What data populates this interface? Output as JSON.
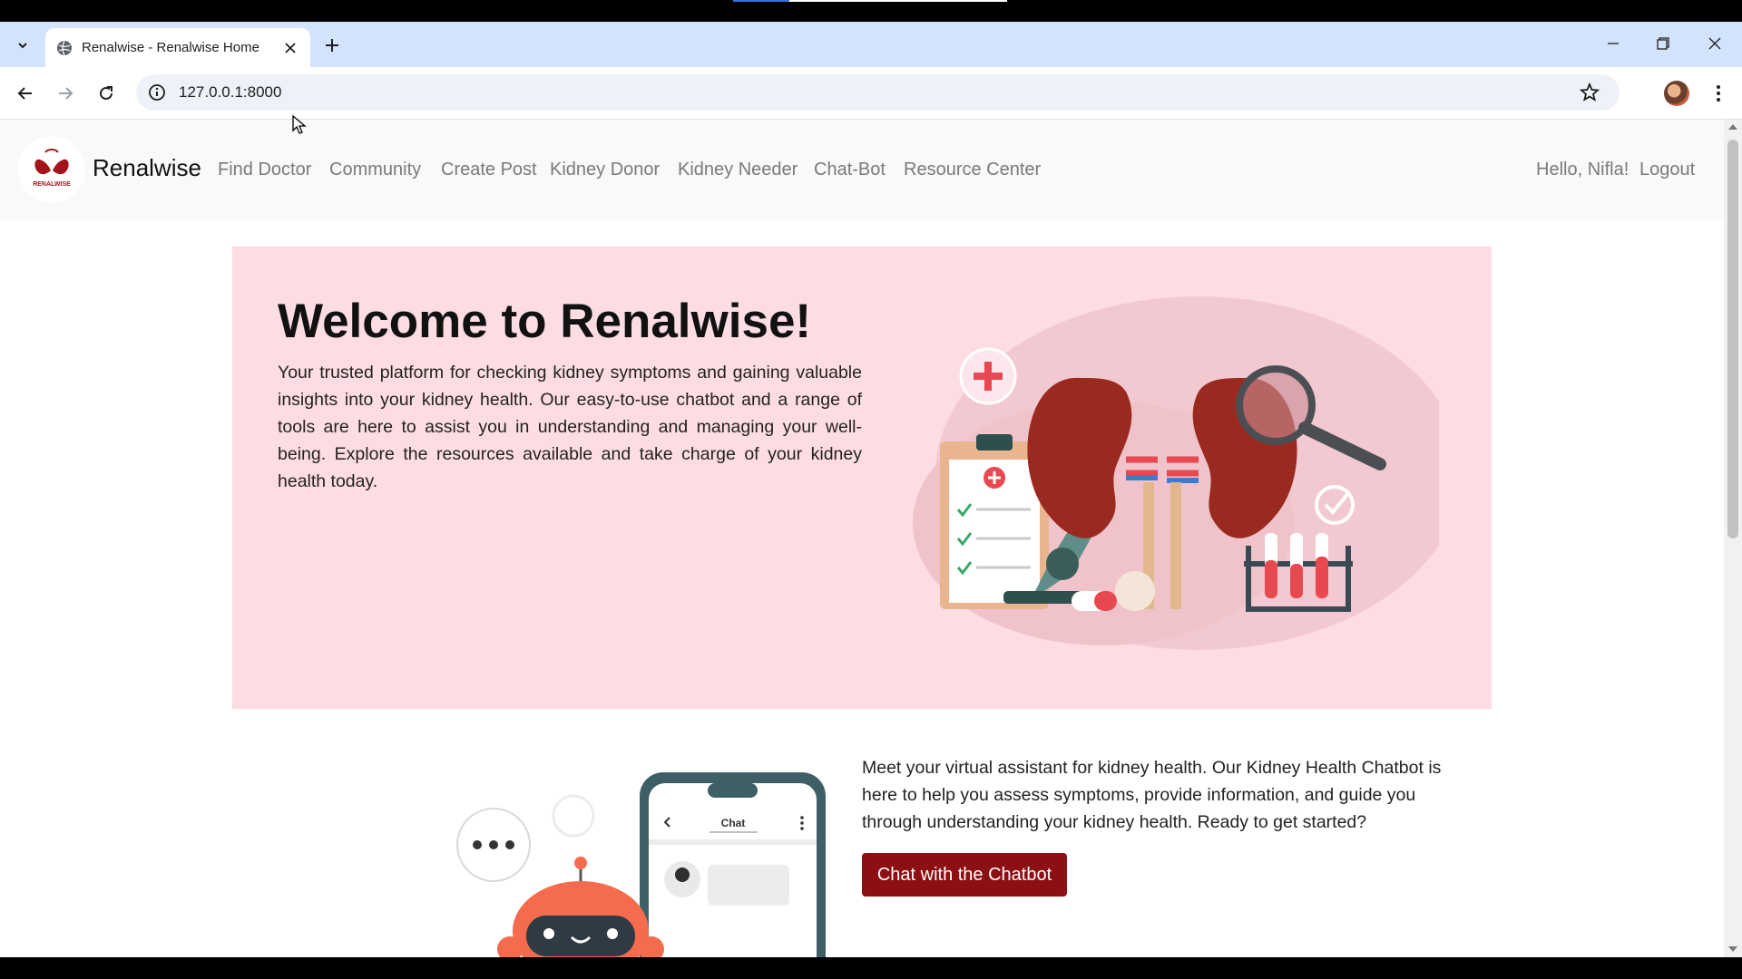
{
  "browser": {
    "tab_title": "Renalwise - Renalwise Home",
    "url": "127.0.0.1:8000"
  },
  "navbar": {
    "brand": "Renalwise",
    "logo_text": "RENALWISE",
    "links": [
      "Find Doctor",
      "Community",
      "Create Post",
      "Kidney Donor",
      "Kidney Needer",
      "Chat-Bot",
      "Resource Center"
    ],
    "greeting": "Hello, Nifla!",
    "logout": "Logout"
  },
  "hero": {
    "title": "Welcome to Renalwise!",
    "description": "Your trusted platform for checking kidney symptoms and gaining valuable insights into your kidney health. Our easy-to-use chatbot and a range of tools are here to assist you in understanding and managing your well-being. Explore the resources available and take charge of your kidney health today."
  },
  "chatbot": {
    "description": "Meet your virtual assistant for kidney health. Our Kidney Health Chatbot is here to help you assess symptoms, provide information, and guide you through understanding your kidney health. Ready to get started?",
    "button": "Chat with the Chatbot",
    "phone_header": "Chat"
  },
  "colors": {
    "hero_bg": "#fddde3",
    "button_bg": "#8b0f13",
    "navbar_bg": "#f8f9fa",
    "tabbar_bg": "#d3e3fd"
  }
}
